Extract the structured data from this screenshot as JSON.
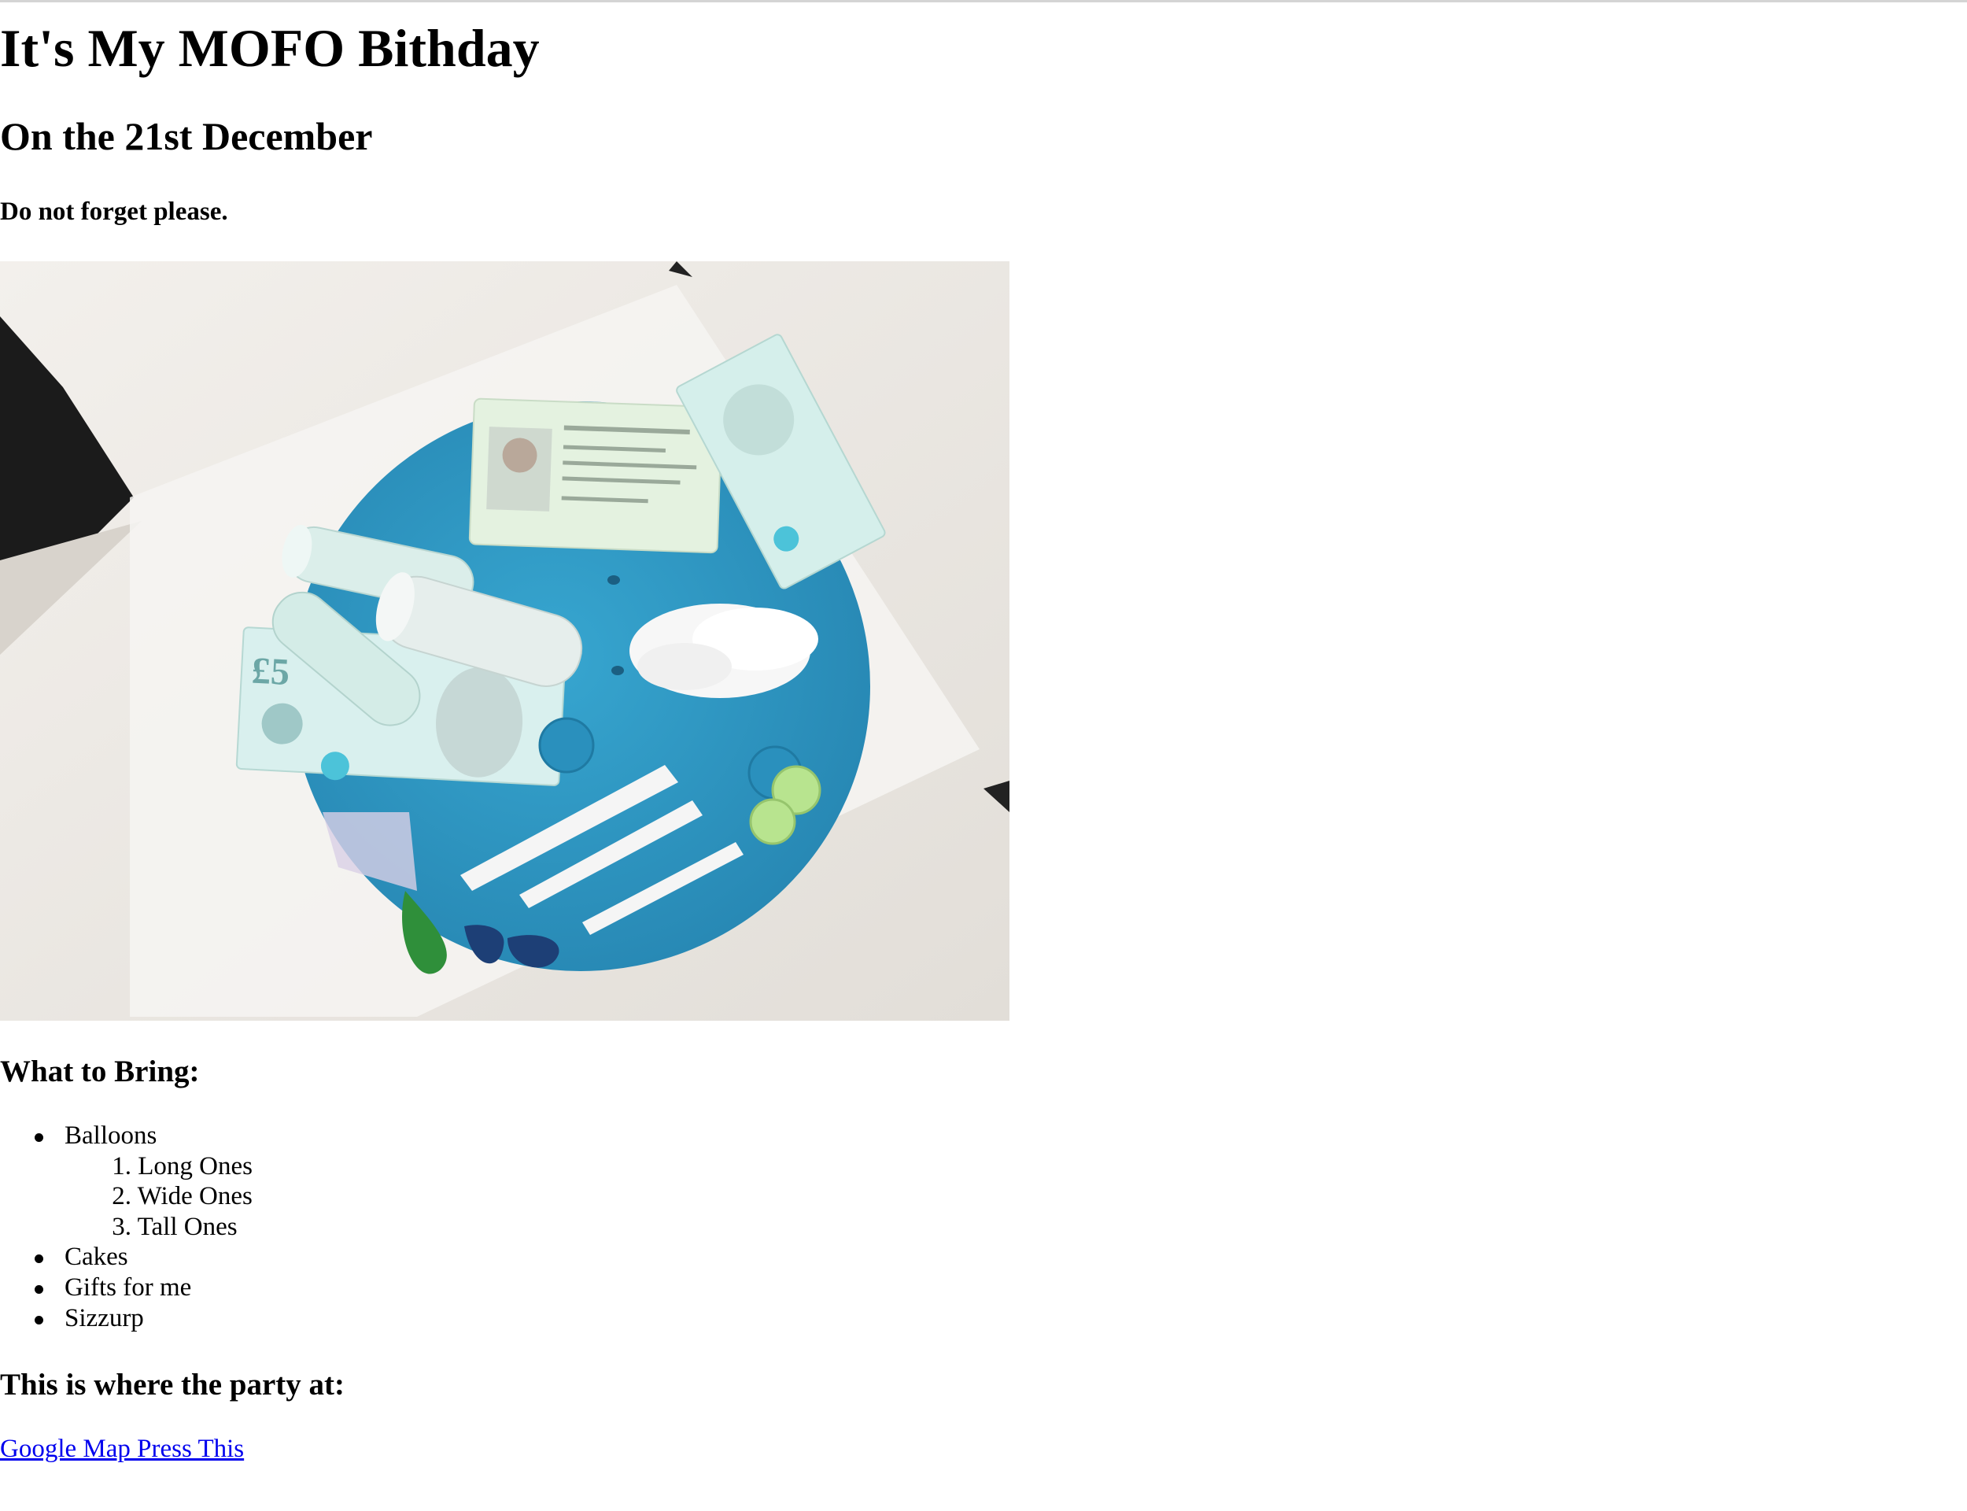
{
  "page": {
    "title": "It's My MOFO Bithday",
    "date_line": "On the 21st December",
    "note": "Do not forget please."
  },
  "photo": {
    "alt": "",
    "colors": {
      "cake_blue": "#2e9bc6",
      "background_cream": "#ece8e3",
      "powder_white": "#f7f7f7",
      "note_teal": "#cfeee7"
    }
  },
  "bring": {
    "heading": "What to Bring:",
    "items": [
      {
        "label": "Balloons",
        "sub_items": [
          {
            "num": "1.",
            "label": "Long Ones"
          },
          {
            "num": "2.",
            "label": "Wide Ones"
          },
          {
            "num": "3.",
            "label": "Tall Ones"
          }
        ]
      },
      {
        "label": "Cakes"
      },
      {
        "label": "Gifts for me"
      },
      {
        "label": "Sizzurp"
      }
    ]
  },
  "party": {
    "heading": "This is where the party at:",
    "link_text": "Google Map Press This",
    "link_color": "#0000ee"
  }
}
